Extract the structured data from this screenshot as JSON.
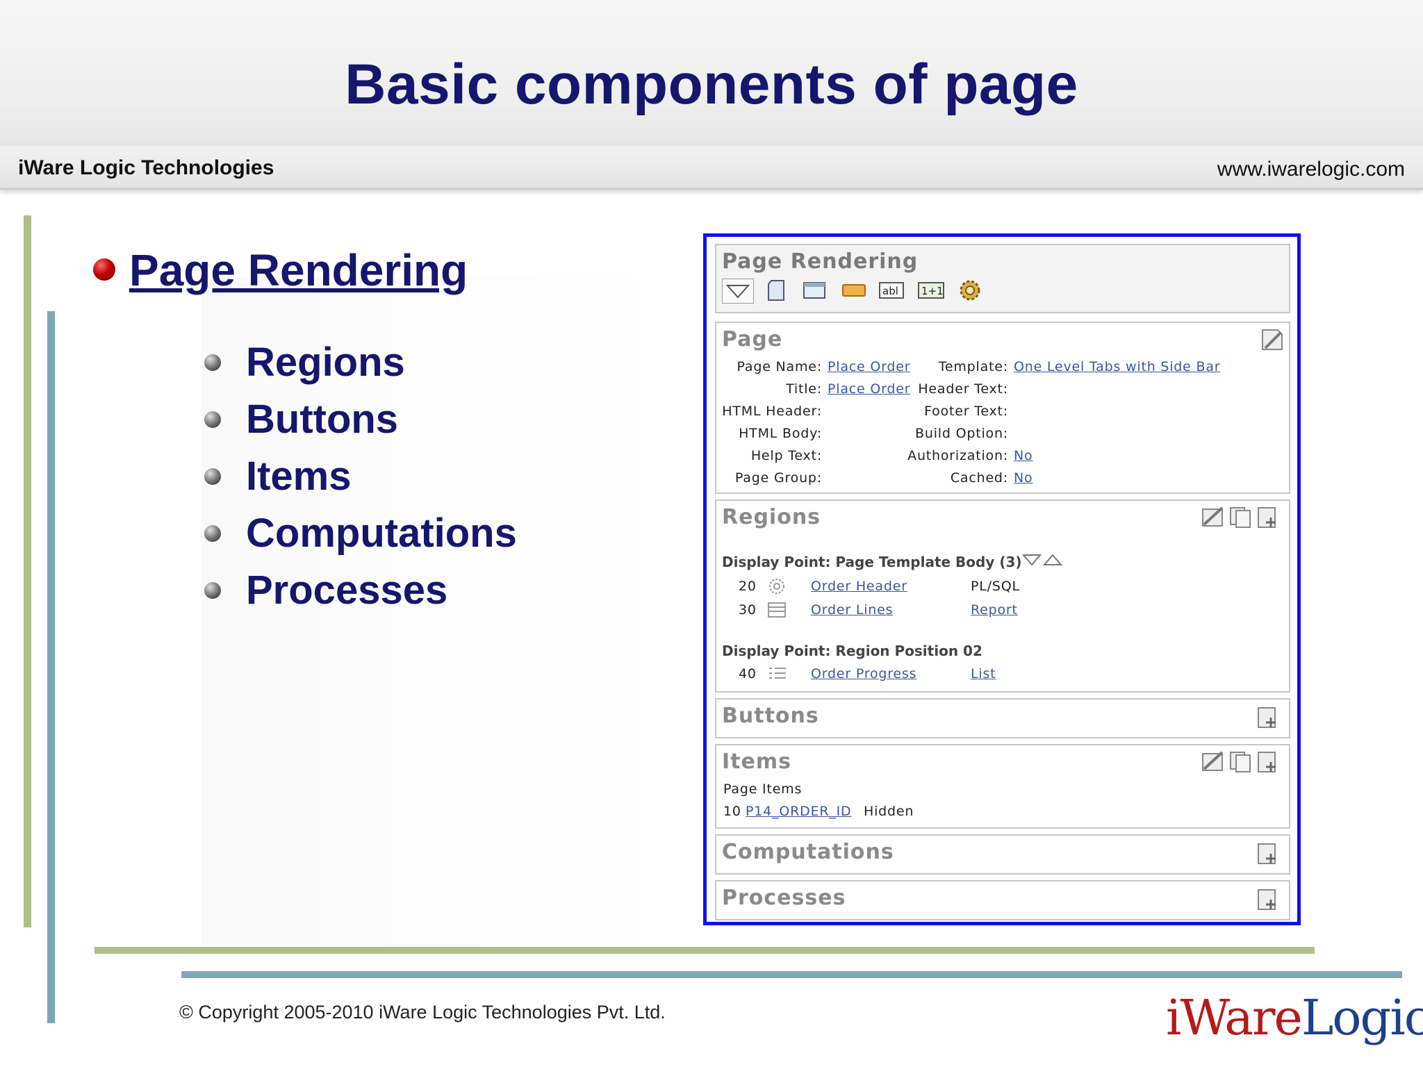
{
  "slide": {
    "title": "Basic components of  page",
    "company_name": "iWare Logic Technologies",
    "company_url": "www.iwarelogic.com",
    "main_topic": "Page Rendering",
    "sub_topics": [
      "Regions",
      "Buttons",
      "Items",
      "Computations",
      "Processes"
    ],
    "copyright": "© Copyright 2005-2010 iWare Logic Technologies Pvt. Ltd.",
    "logo": {
      "part1": "iWare",
      "part2": "Logic"
    }
  },
  "screenshot": {
    "rendering": {
      "header": "Page Rendering",
      "toolbar_icons": [
        "expand-triangle-icon",
        "page-icon",
        "region-icon",
        "button-icon",
        "text-item-icon",
        "computation-icon",
        "process-gear-icon"
      ],
      "toolbar_labels": {
        "text_item": "abl",
        "computation": "1+1"
      }
    },
    "page": {
      "header": "Page",
      "left": [
        {
          "label": "Page Name:",
          "value": "Place Order"
        },
        {
          "label": "Title:",
          "value": "Place Order"
        },
        {
          "label": "HTML Header:",
          "value": ""
        },
        {
          "label": "HTML Body:",
          "value": ""
        },
        {
          "label": "Help Text:",
          "value": ""
        },
        {
          "label": "Page Group:",
          "value": ""
        }
      ],
      "right": [
        {
          "label": "Template:",
          "value": "One Level Tabs with Side Bar"
        },
        {
          "label": "Header Text:",
          "value": ""
        },
        {
          "label": "Footer Text:",
          "value": ""
        },
        {
          "label": "Build Option:",
          "value": ""
        },
        {
          "label": "Authorization:",
          "value": "No"
        },
        {
          "label": "Cached:",
          "value": "No"
        }
      ]
    },
    "regions": {
      "header": "Regions",
      "groups": [
        {
          "display_point": "Display Point: Page Template Body (3)",
          "rows": [
            {
              "seq": "20",
              "icon": "plsql-gear-icon",
              "name": "Order Header",
              "type": "PL/SQL"
            },
            {
              "seq": "30",
              "icon": "report-grid-icon",
              "name": "Order Lines",
              "type": "Report"
            }
          ]
        },
        {
          "display_point": "Display Point: Region Position 02",
          "rows": [
            {
              "seq": "40",
              "icon": "list-icon",
              "name": "Order Progress",
              "type": "List"
            }
          ]
        }
      ]
    },
    "buttons": {
      "header": "Buttons"
    },
    "items": {
      "header": "Items",
      "subheader": "Page Items",
      "row": {
        "seq": "10",
        "name": "P14_ORDER_ID",
        "type": "Hidden"
      }
    },
    "computations": {
      "header": "Computations"
    },
    "processes": {
      "header": "Processes"
    }
  }
}
